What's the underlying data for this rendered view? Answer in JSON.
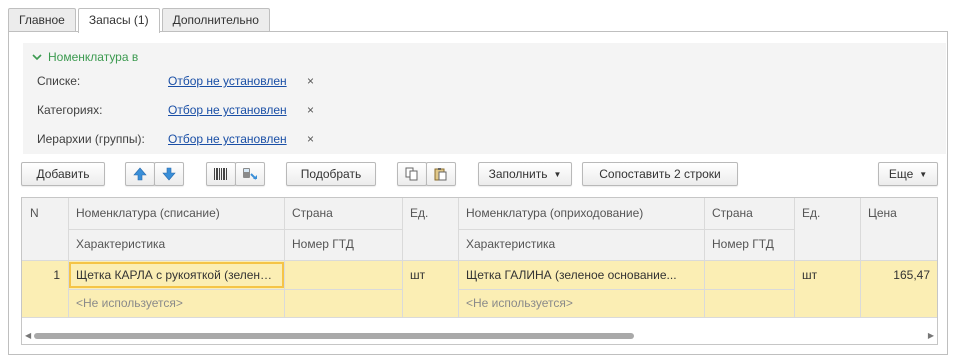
{
  "tabs": [
    {
      "label": "Главное",
      "active": false
    },
    {
      "label": "Запасы (1)",
      "active": true
    },
    {
      "label": "Дополнительно",
      "active": false
    }
  ],
  "filter": {
    "title": "Номенклатура в",
    "rows": [
      {
        "label": "Списке:",
        "value": "Отбор не установлен",
        "clear": "×"
      },
      {
        "label": "Категориях:",
        "value": "Отбор не установлен",
        "clear": "×"
      },
      {
        "label": "Иерархии (группы):",
        "value": "Отбор не установлен",
        "clear": "×"
      }
    ]
  },
  "toolbar": {
    "add": "Добавить",
    "pick": "Подобрать",
    "fill": "Заполнить",
    "match": "Сопоставить 2 строки",
    "more": "Еще",
    "dropdown_glyph": "▼",
    "icons": [
      "arrow-up-icon",
      "arrow-down-icon",
      "barcode-icon",
      "barcode-scanner-icon",
      "copy-icon",
      "paste-icon"
    ]
  },
  "table": {
    "headers": {
      "n": "N",
      "nom_out": "Номенклатура (списание)",
      "char_out": "Характеристика",
      "country_out": "Страна",
      "gtd_out": "Номер ГТД",
      "unit_out": "Ед.",
      "nom_in": "Номенклатура (оприходование)",
      "char_in": "Характеристика",
      "country_in": "Страна",
      "gtd_in": "Номер ГТД",
      "unit_in": "Ед.",
      "price": "Цена"
    },
    "rows": [
      {
        "n": "1",
        "nom_out": "Щетка КАРЛА с рукояткой (зеленое основание)",
        "char_out": "<Не используется>",
        "country_out": "",
        "gtd_out": "",
        "unit_out": "шт",
        "nom_in": "Щетка ГАЛИНА (зеленое основание...",
        "char_in": "<Не используется>",
        "country_in": "",
        "gtd_in": "",
        "unit_in": "шт",
        "price": "165,47"
      }
    ]
  },
  "scrollbar": {
    "left_arrow": "◀",
    "right_arrow": "▶"
  },
  "colors": {
    "accent_green": "#3c9a50",
    "link_blue": "#1a4fa6",
    "row_highlight": "#fbeeb4",
    "focus_border": "#f5c447"
  }
}
